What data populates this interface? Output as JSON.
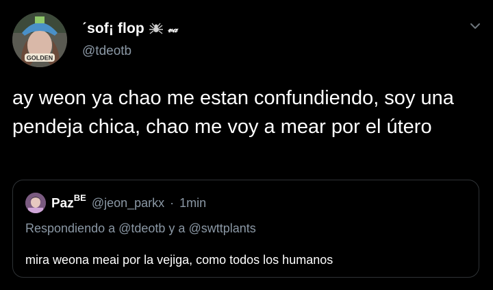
{
  "tweet": {
    "author": {
      "display_name": "ˊsof¡ flop",
      "name_suffix": "𝓋𝒶",
      "handle": "@tdeotb",
      "avatar_caption": "GOLDEN"
    },
    "text": "ay weon ya chao me estan confundiendo, soy una pendeja chica, chao me voy a mear por el útero",
    "menu_icon": "chevron-down-icon"
  },
  "quoted_tweet": {
    "display_name": "Paz",
    "name_superscript": "BE",
    "handle": "@jeon_parkx",
    "separator": "·",
    "time": "1min",
    "replying_to": "Respondiendo a @tdeotb y a @swttplants",
    "text": "mira weona meai por la vejiga, como todos los humanos"
  },
  "colors": {
    "background": "#000000",
    "primary_text": "#ffffff",
    "secondary_text": "#8b98a5",
    "border": "#2f3336"
  }
}
